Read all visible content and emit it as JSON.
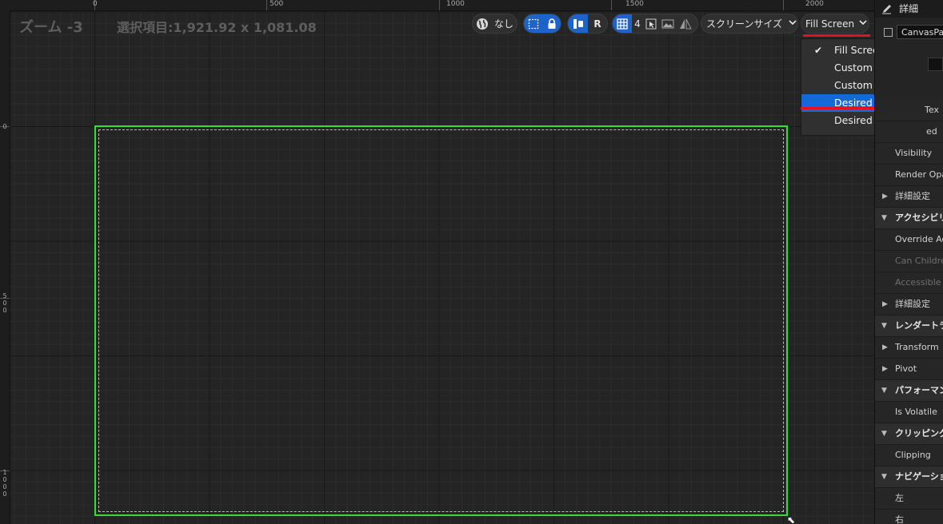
{
  "canvas": {
    "zoom_label": "ズーム -3",
    "selection_label": "選択項目:1,921.92 x 1,081.08",
    "ruler_top": [
      "0",
      "500",
      "1000",
      "1500",
      "2000"
    ],
    "ruler_left": [
      "0",
      "500",
      "1000"
    ]
  },
  "toolbar": {
    "localization_label": "なし",
    "rtl_label": "R",
    "grid_snap_value": "4",
    "screen_size_label": "スクリーンサイズ",
    "fill_screen_label": "Fill Screen",
    "icons": [
      "globe-icon",
      "marquee-select-icon",
      "lock-icon",
      "respect-lock-icon",
      "grid-icon",
      "cursor-icon",
      "image-icon",
      "flip-icon",
      "chevron-down-icon"
    ]
  },
  "dropdown": {
    "selected": "Fill Screen",
    "highlighted": "Desired",
    "items": [
      "Fill Screen",
      "Custom",
      "Custom on Screen",
      "Desired",
      "Desired on Screen"
    ]
  },
  "details": {
    "title": "詳細",
    "widget_name": "CanvasPanel",
    "rows": [
      {
        "type": "sub",
        "label": "Tex"
      },
      {
        "type": "sub",
        "label": "ed"
      },
      {
        "type": "sub",
        "label": "Visibility"
      },
      {
        "type": "sub",
        "label": "Render Opacity"
      },
      {
        "type": "grp",
        "label": "詳細設定"
      },
      {
        "type": "cat",
        "label": "アクセシビリティ"
      },
      {
        "type": "sub",
        "label": "Override Accessible"
      },
      {
        "type": "dim",
        "label": "Can Children be Accessible"
      },
      {
        "type": "dim",
        "label": "Accessible Behavior"
      },
      {
        "type": "grp",
        "label": "詳細設定"
      },
      {
        "type": "cat",
        "label": "レンダートランスフォーム"
      },
      {
        "type": "grp",
        "label": "Transform"
      },
      {
        "type": "grp",
        "label": "Pivot"
      },
      {
        "type": "cat",
        "label": "パフォーマンス"
      },
      {
        "type": "sub",
        "label": "Is Volatile"
      },
      {
        "type": "cat",
        "label": "クリッピング"
      },
      {
        "type": "sub",
        "label": "Clipping"
      },
      {
        "type": "cat",
        "label": "ナビゲーション"
      },
      {
        "type": "sub",
        "label": "左"
      },
      {
        "type": "sub",
        "label": "右"
      }
    ]
  },
  "colors": {
    "selection_outline": "#2fe02f",
    "annotation_red": "#e8101e",
    "highlight_blue": "#1469d6",
    "toggle_active": "#1e63c8"
  }
}
